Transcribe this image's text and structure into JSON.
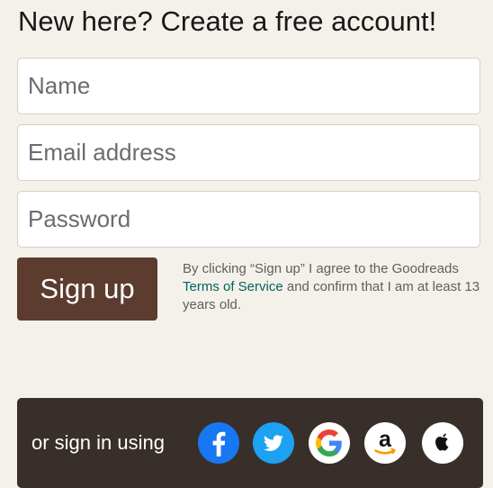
{
  "heading": "New here? Create a free account!",
  "form": {
    "name_placeholder": "Name",
    "email_placeholder": "Email address",
    "password_placeholder": "Password",
    "signup_label": "Sign up"
  },
  "terms": {
    "prefix": "By clicking “Sign up” I agree to the Goodreads ",
    "link": "Terms of Service",
    "suffix": " and confirm that I am at least 13 years old."
  },
  "social": {
    "label": "or sign in using",
    "providers": [
      "facebook-icon",
      "twitter-icon",
      "google-icon",
      "amazon-icon",
      "apple-icon"
    ],
    "colors": {
      "facebook": "#1877f2",
      "twitter": "#1da1f2",
      "google_blue": "#4285f4",
      "google_red": "#ea4335",
      "google_yellow": "#fbbc05",
      "google_green": "#34a853",
      "amazon_orange": "#ff9900"
    }
  },
  "colors": {
    "background": "#f4f1ea",
    "signup_button": "#5c3c2f",
    "social_bar": "#382f2a",
    "link": "#00635d"
  }
}
